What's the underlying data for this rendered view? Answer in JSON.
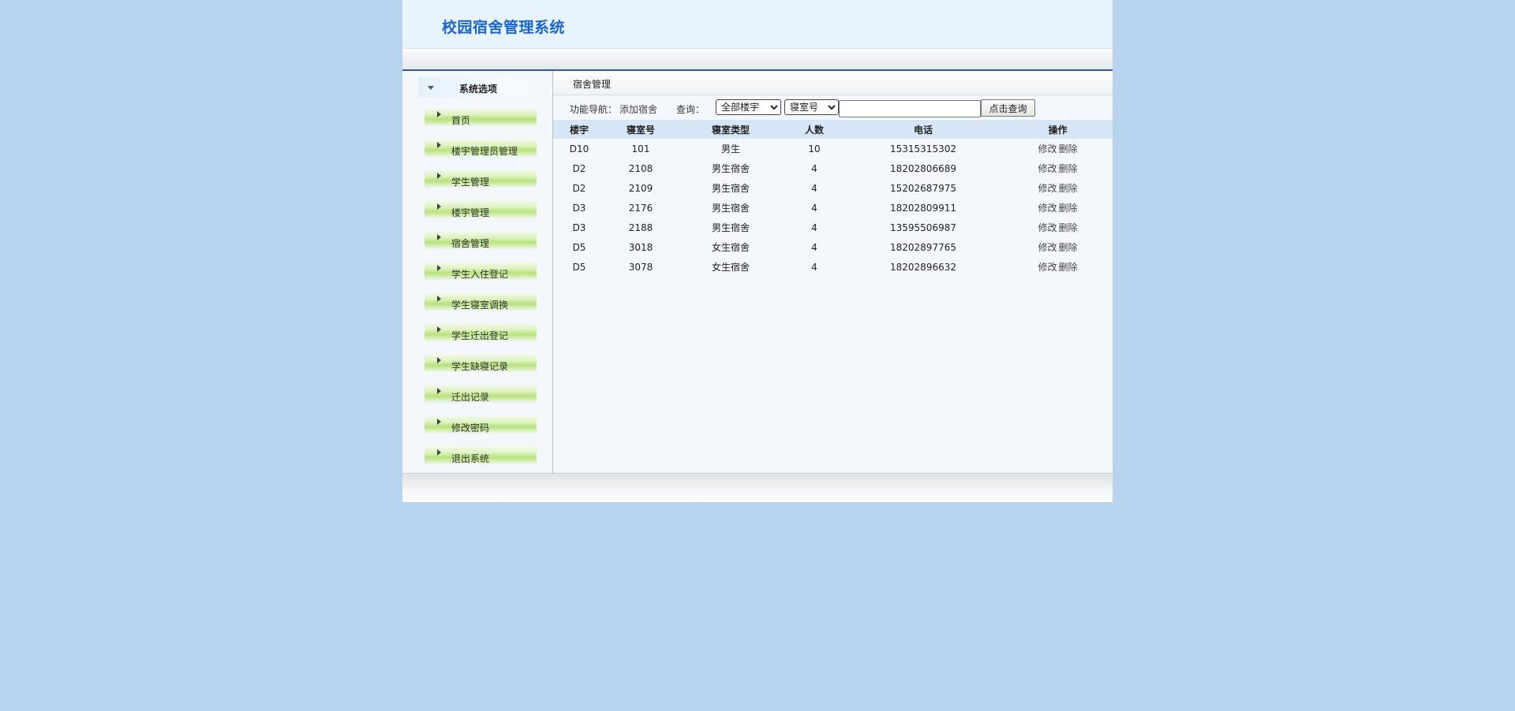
{
  "app": {
    "title": "校园宿舍管理系统"
  },
  "sidebar": {
    "header": "系统选项",
    "items": [
      {
        "label": "首页"
      },
      {
        "label": "楼宇管理员管理"
      },
      {
        "label": "学生管理"
      },
      {
        "label": "楼宇管理"
      },
      {
        "label": "宿舍管理"
      },
      {
        "label": "学生入住登记"
      },
      {
        "label": "学生寝室调换"
      },
      {
        "label": "学生迁出登记"
      },
      {
        "label": "学生缺寝记录"
      },
      {
        "label": "迁出记录"
      },
      {
        "label": "修改密码"
      },
      {
        "label": "退出系统"
      }
    ]
  },
  "content": {
    "title": "宿舍管理",
    "nav": {
      "label": "功能导航：",
      "add_link": "添加宿舍",
      "query_label": "查询：",
      "building_select": "全部楼宇",
      "field_select": "寝室号",
      "keyword_value": "",
      "search_button": "点击查询"
    },
    "table": {
      "columns": [
        "楼宇",
        "寝室号",
        "寝室类型",
        "人数",
        "电话",
        "操作"
      ],
      "edit_label": "修改",
      "delete_label": "删除",
      "rows": [
        {
          "building": "D10",
          "room": "101",
          "type": "男生",
          "count": "10",
          "phone": "15315315302"
        },
        {
          "building": "D2",
          "room": "2108",
          "type": "男生宿舍",
          "count": "4",
          "phone": "18202806689"
        },
        {
          "building": "D2",
          "room": "2109",
          "type": "男生宿舍",
          "count": "4",
          "phone": "15202687975"
        },
        {
          "building": "D3",
          "room": "2176",
          "type": "男生宿舍",
          "count": "4",
          "phone": "18202809911"
        },
        {
          "building": "D3",
          "room": "2188",
          "type": "男生宿舍",
          "count": "4",
          "phone": "13595506987"
        },
        {
          "building": "D5",
          "room": "3018",
          "type": "女生宿舍",
          "count": "4",
          "phone": "18202897765"
        },
        {
          "building": "D5",
          "room": "3078",
          "type": "女生宿舍",
          "count": "4",
          "phone": "18202896632"
        }
      ]
    }
  },
  "colors": {
    "page_background": "#b8d3ee",
    "title_blue": "#1a66c9",
    "menu_green": "#b7e27a",
    "table_header": "#d6e6f6"
  }
}
